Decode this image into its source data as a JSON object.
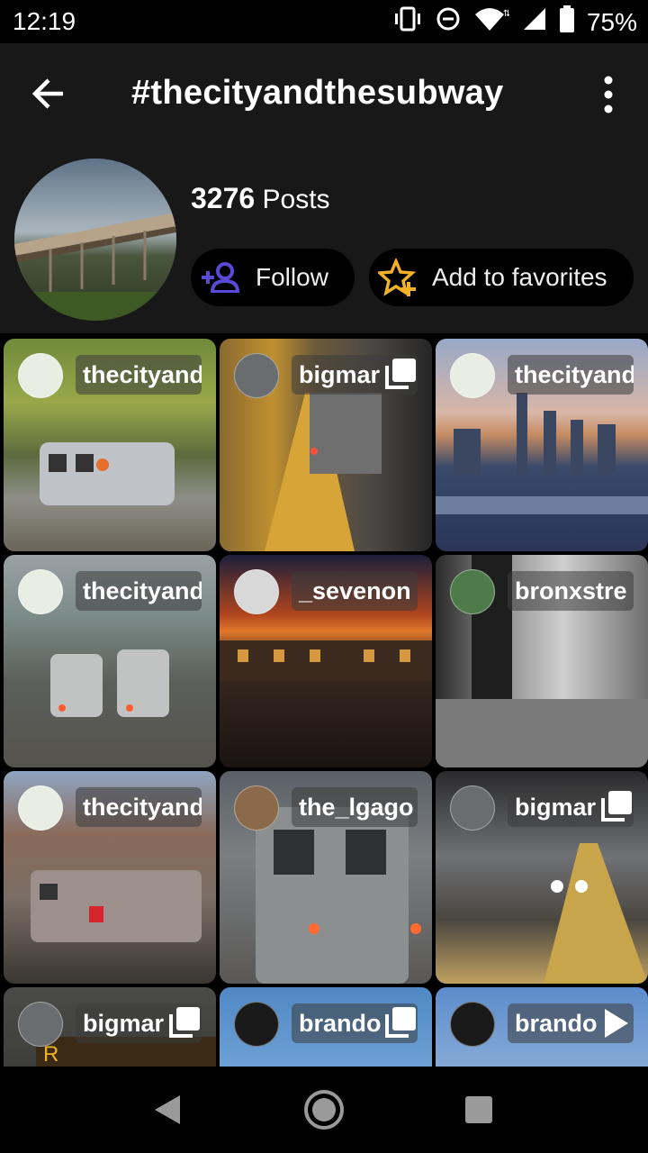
{
  "status": {
    "time": "12:19",
    "battery": "75%"
  },
  "appbar": {
    "title": "#thecityandthesubway"
  },
  "header": {
    "post_count": "3276",
    "posts_label": "Posts",
    "follow_label": "Follow",
    "favorites_label": "Add to favorites"
  },
  "tiles": [
    {
      "user": "thecityandthesubway",
      "badge": "none"
    },
    {
      "user": "bigmar",
      "badge": "multi"
    },
    {
      "user": "thecityandthesubway",
      "badge": "none"
    },
    {
      "user": "thecityandthesubway",
      "badge": "none"
    },
    {
      "user": "_sevenon",
      "badge": "none"
    },
    {
      "user": "bronxstre",
      "badge": "none"
    },
    {
      "user": "thecityandthesubway",
      "badge": "none"
    },
    {
      "user": "the_lgago",
      "badge": "none"
    },
    {
      "user": "bigmar",
      "badge": "multi"
    },
    {
      "user": "bigmar",
      "badge": "multi"
    },
    {
      "user": "brando",
      "badge": "multi"
    },
    {
      "user": "brando",
      "badge": "video"
    }
  ],
  "icons": {
    "back": "arrow-left-icon",
    "menu": "more-vertical-icon",
    "follow": "person-add-icon",
    "favorite": "star-plus-icon",
    "multi": "carousel-icon",
    "video": "play-icon",
    "nav_back": "nav-back-icon",
    "nav_home": "nav-home-icon",
    "nav_recents": "nav-recents-icon"
  },
  "colors": {
    "accent": "#5a48d6",
    "star": "#f2b227",
    "appbar": "#181818"
  }
}
